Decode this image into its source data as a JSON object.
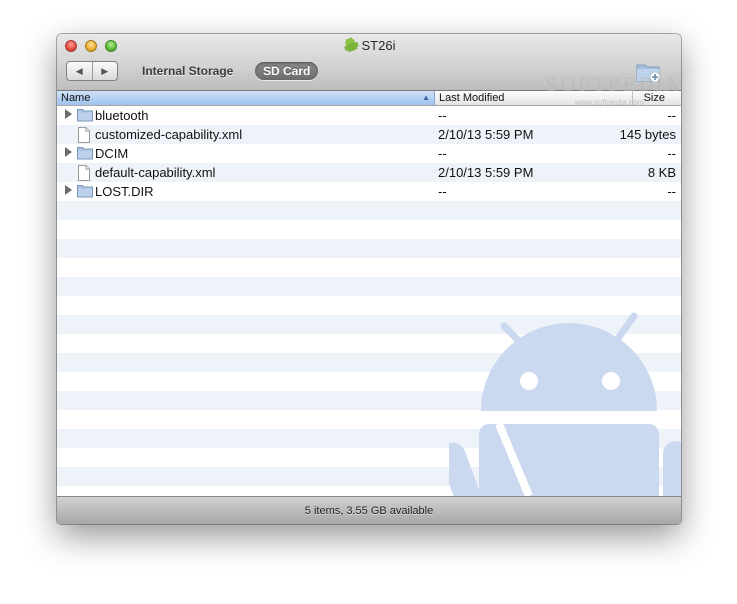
{
  "window": {
    "title": "ST26i",
    "title_icon": "android-icon"
  },
  "toolbar": {
    "back_label": "◀",
    "forward_label": "▶",
    "tab_internal": "Internal Storage",
    "tab_sd": "SD Card",
    "selected_tab": "SD Card",
    "new_folder_icon": "new-folder-icon"
  },
  "columns": {
    "name": "Name",
    "modified": "Last Modified",
    "size": "Size",
    "sort_column": "Name",
    "sort_direction": "ascending"
  },
  "files": [
    {
      "name": "bluetooth",
      "type": "folder",
      "modified": "--",
      "size": "--"
    },
    {
      "name": "customized-capability.xml",
      "type": "file",
      "modified": "2/10/13 5:59 PM",
      "size": "145 bytes"
    },
    {
      "name": "DCIM",
      "type": "folder",
      "modified": "--",
      "size": "--"
    },
    {
      "name": "default-capability.xml",
      "type": "file",
      "modified": "2/10/13 5:59 PM",
      "size": "8 KB"
    },
    {
      "name": "LOST.DIR",
      "type": "folder",
      "modified": "--",
      "size": "--"
    }
  ],
  "status": {
    "text": "5 items, 3.55 GB available"
  },
  "watermark": {
    "brand": "SOFTPEDIA",
    "url": "www.softpedia.com"
  },
  "colors": {
    "selected_header": "#9ec2ee",
    "row_stripe": "#eef3fa",
    "android_bg": "#c8d8f0"
  }
}
